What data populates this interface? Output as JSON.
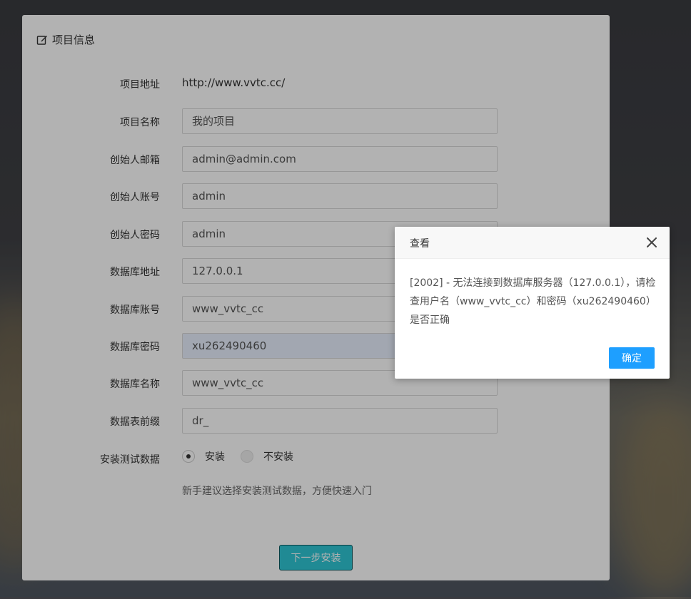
{
  "panel": {
    "title": "项目信息",
    "fields": [
      {
        "label": "项目地址",
        "value": "http://www.vvtc.cc/"
      },
      {
        "label": "项目名称",
        "value": "我的项目"
      },
      {
        "label": "创始人邮箱",
        "value": "admin@admin.com"
      },
      {
        "label": "创始人账号",
        "value": "admin"
      },
      {
        "label": "创始人密码",
        "value": "admin"
      },
      {
        "label": "数据库地址",
        "value": "127.0.0.1"
      },
      {
        "label": "数据库账号",
        "value": "www_vvtc_cc"
      },
      {
        "label": "数据库密码",
        "value": "xu262490460"
      },
      {
        "label": "数据库名称",
        "value": "www_vvtc_cc"
      },
      {
        "label": "数据表前缀",
        "value": "dr_"
      }
    ],
    "test_data": {
      "label": "安装测试数据",
      "option_install": "安装",
      "option_no_install": "不安装",
      "selected": "安装",
      "hint": "新手建议选择安装测试数据，方便快速入门"
    },
    "next_button": "下一步安装"
  },
  "dialog": {
    "title": "查看",
    "message": "[2002] - 无法连接到数据库服务器（127.0.0.1），请检查用户名（www_vvtc_cc）和密码（xu262490460）是否正确",
    "ok_button": "确定"
  },
  "colors": {
    "next_button": "#2ec6d4",
    "ok_button": "#1e9fff"
  }
}
